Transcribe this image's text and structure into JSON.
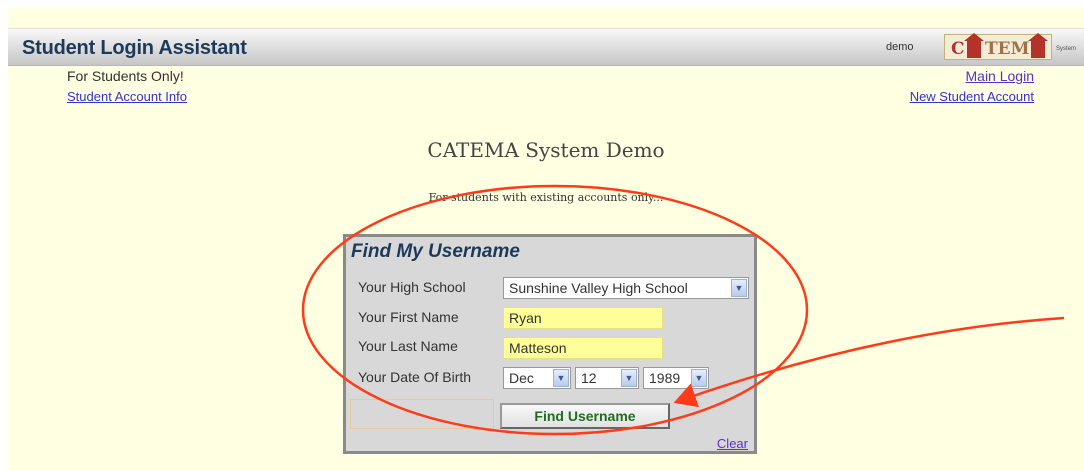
{
  "header": {
    "title": "Student Login Assistant",
    "user": "demo",
    "logo_text": "CATEMA",
    "logo_subtext": "System"
  },
  "subheader": {
    "left_text": "For Students Only!",
    "left_link": "Student Account Info",
    "right_link_1": "Main Login",
    "right_link_2": "New Student Account"
  },
  "main": {
    "system_title": "CATEMA System Demo",
    "notice": "For students with existing accounts only..."
  },
  "form": {
    "title": "Find My Username",
    "school_label": "Your High School",
    "school_value": "Sunshine Valley High School",
    "first_name_label": "Your First Name",
    "first_name_value": "Ryan",
    "last_name_label": "Your Last Name",
    "last_name_value": "Matteson",
    "dob_label": "Your Date Of Birth",
    "dob_month": "Dec",
    "dob_day": "12",
    "dob_year": "1989",
    "submit_label": "Find Username",
    "clear_label": "Clear"
  },
  "colors": {
    "page_bg": "#ffffe1",
    "annotation": "#ff3b1a",
    "field_highlight": "#ffff99",
    "button_text": "#1f6e1f"
  },
  "icons": {
    "select_arrow": "chevron-down-icon"
  }
}
